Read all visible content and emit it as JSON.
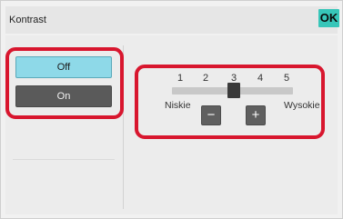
{
  "header": {
    "title": "Kontrast",
    "ok_label": "OK"
  },
  "toggle": {
    "off_label": "Off",
    "on_label": "On",
    "selected": "Off"
  },
  "slider": {
    "scale_labels": [
      "1",
      "2",
      "3",
      "4",
      "5"
    ],
    "min": 1,
    "max": 5,
    "value": 3,
    "low_label": "Niskie",
    "high_label": "Wysokie",
    "minus_label": "−",
    "plus_label": "+"
  },
  "colors": {
    "ok_button": "#37c6b9",
    "selected_toggle": "#8ed9e8",
    "unselected_toggle": "#5a5a5a",
    "highlight": "#d8162e"
  }
}
